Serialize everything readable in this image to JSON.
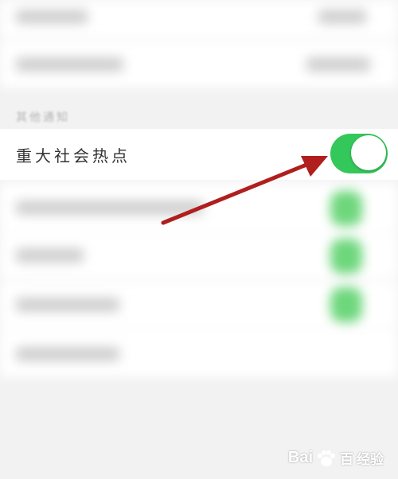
{
  "section": {
    "label": "其他通知"
  },
  "focus_row": {
    "label": "重大社会热点",
    "toggle_state": "on"
  },
  "colors": {
    "toggle_on": "#34c759",
    "arrow": "#b01e1e",
    "blurred_green": "#6ed77c"
  },
  "watermark": {
    "brand": "Bai",
    "brand2": "百",
    "sub": "经验"
  },
  "icons": [
    "paw-icon"
  ]
}
